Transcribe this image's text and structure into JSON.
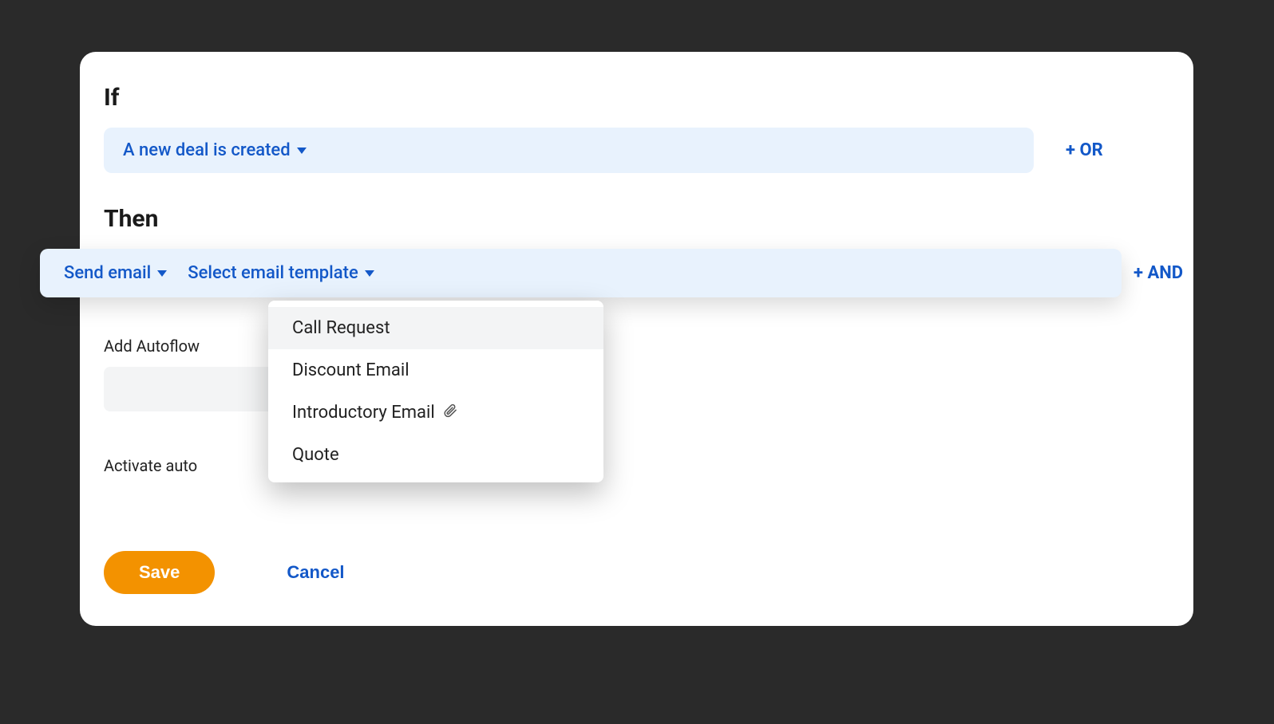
{
  "if": {
    "label": "If",
    "condition_label": "A new deal is created",
    "or_label": "+ OR"
  },
  "then": {
    "label": "Then",
    "action_label": "Send email",
    "template_label": "Select email template",
    "and_label": "+ AND",
    "template_options": [
      {
        "label": "Call Request",
        "has_attachment": false
      },
      {
        "label": "Discount Email",
        "has_attachment": false
      },
      {
        "label": "Introductory Email",
        "has_attachment": true
      },
      {
        "label": "Quote",
        "has_attachment": false
      }
    ]
  },
  "autoflow": {
    "label": "Add Autoflow"
  },
  "activate": {
    "label": "Activate auto"
  },
  "footer": {
    "save_label": "Save",
    "cancel_label": "Cancel"
  }
}
